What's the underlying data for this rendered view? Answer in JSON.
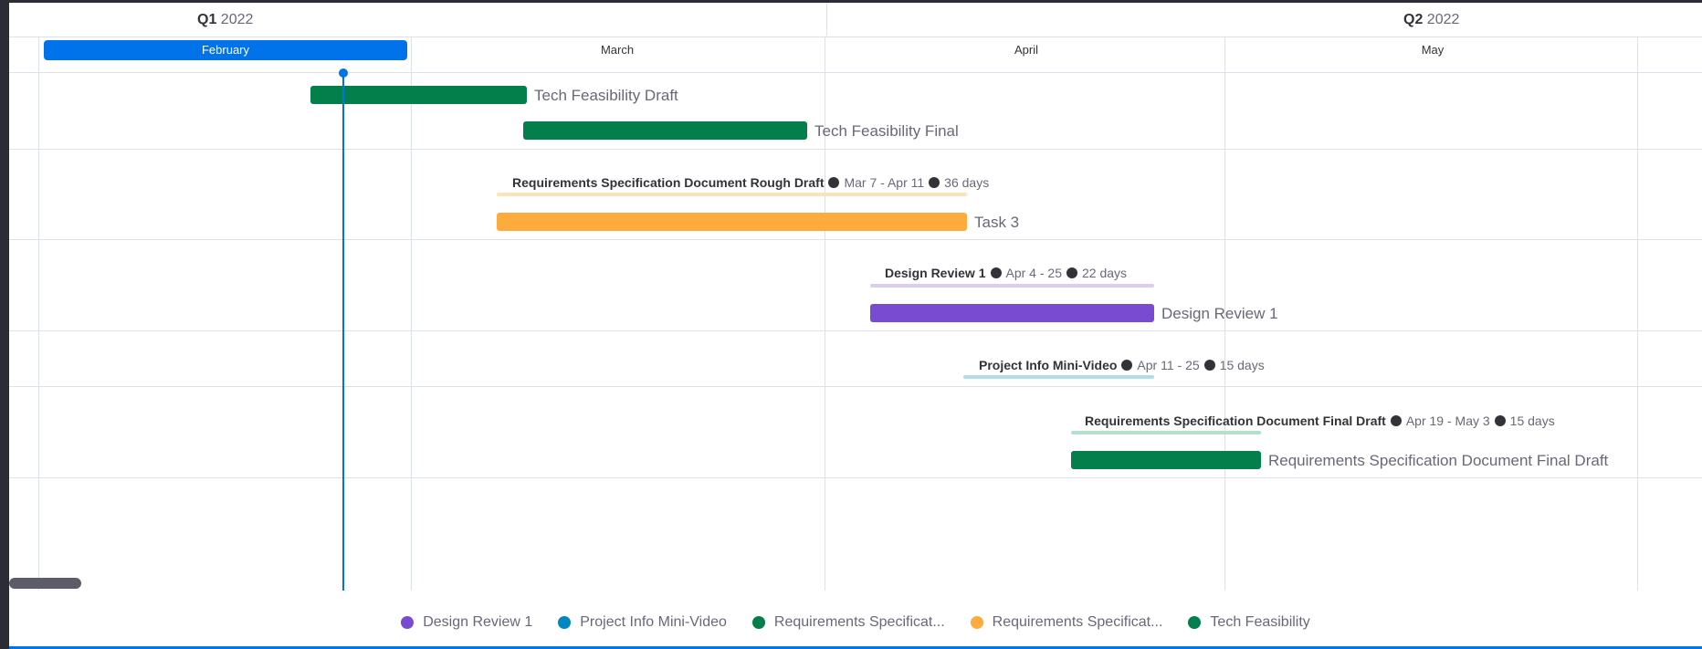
{
  "timeline": {
    "quarters": [
      {
        "q": "Q1",
        "year": "2022"
      },
      {
        "q": "Q2",
        "year": "2022"
      }
    ],
    "months": [
      "February",
      "March",
      "April",
      "May"
    ],
    "active_month": "February"
  },
  "tasks": [
    {
      "label": "Tech Feasibility Draft",
      "color": "#037f4c"
    },
    {
      "label": "Tech Feasibility Final",
      "color": "#037f4c"
    },
    {
      "label": "Task 3",
      "color": "#fdab3d",
      "group": {
        "name": "Requirements Specification Document Rough Draft",
        "dates": "Mar 7 - Apr 11",
        "duration": "36 days"
      }
    },
    {
      "label": "Design Review 1",
      "color": "#784bd1",
      "group": {
        "name": "Design Review 1",
        "dates": "Apr 4 - 25",
        "duration": "22 days"
      }
    },
    {
      "label": "",
      "color": "#0086c0",
      "group": {
        "name": "Project Info Mini-Video",
        "dates": "Apr 11 - 25",
        "duration": "15 days"
      }
    },
    {
      "label": "Requirements Specification Document Final Draft",
      "color": "#037f4c",
      "group": {
        "name": "Requirements Specification Document Final Draft",
        "dates": "Apr 19 - May 3",
        "duration": "15 days"
      }
    }
  ],
  "legend": [
    {
      "label": "Design Review 1",
      "color": "#784bd1"
    },
    {
      "label": "Project Info Mini-Video",
      "color": "#0086c0"
    },
    {
      "label": "Requirements Specificat...",
      "color": "#037f4c"
    },
    {
      "label": "Requirements Specificat...",
      "color": "#fdab3d"
    },
    {
      "label": "Tech Feasibility",
      "color": "#037f4c"
    }
  ],
  "today_marker_color": "#0073ea"
}
